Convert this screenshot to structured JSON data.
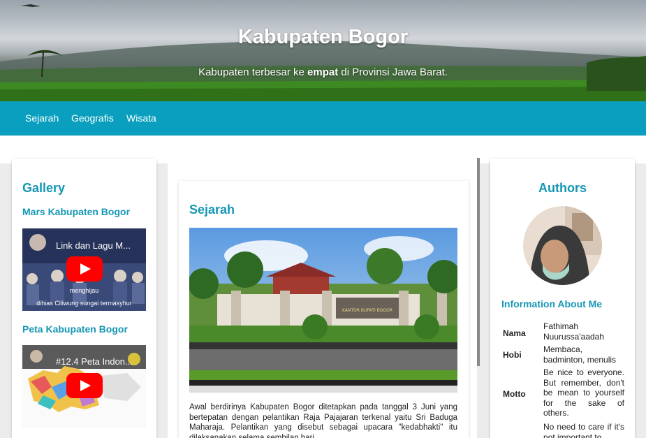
{
  "hero": {
    "title": "Kabupaten Bogor",
    "subtitle_pre": "Kabupaten terbesar ke ",
    "subtitle_bold": "empat",
    "subtitle_post": " di Provinsi Jawa Barat."
  },
  "nav": {
    "items": [
      "Sejarah",
      "Geografis",
      "Wisata"
    ]
  },
  "gallery": {
    "title": "Gallery",
    "video1": {
      "heading": "Mars Kabupaten Bogor",
      "title": "Link dan Lagu M...",
      "caption1": "menghijau",
      "caption2": "dihias Ciliwung sungai termasyhur"
    },
    "video2": {
      "heading": "Peta Kabupaten Bogor",
      "title": "#12.4 Peta Indon..."
    }
  },
  "main": {
    "title": "Sejarah",
    "image_sign": "KANTOR BUPATI BOGOR",
    "paragraph": "Awal berdirinya Kabupaten Bogor ditetapkan pada tanggal 3 Juni yang bertepatan dengan pelantikan Raja Pajajaran terkenal yaitu Sri Baduga Maharaja. Pelantikan yang disebut sebagai upacara \"kedabhakti\" itu dilaksanakan selama sembilan hari"
  },
  "authors": {
    "title": "Authors",
    "info_title": "Information About Me",
    "rows": [
      {
        "key": "Nama",
        "value": "Fathimah Nuurussa'aadah"
      },
      {
        "key": "Hobi",
        "value": "Membaca, badminton, menulis"
      },
      {
        "key": "Motto",
        "value": "Be nice to everyone. But remember, don't be mean to yourself for the sake of others."
      },
      {
        "key": "",
        "value": "No need to care if it's not important to"
      }
    ]
  },
  "colors": {
    "accent": "#0a9fbe",
    "heading": "#1597b5"
  }
}
